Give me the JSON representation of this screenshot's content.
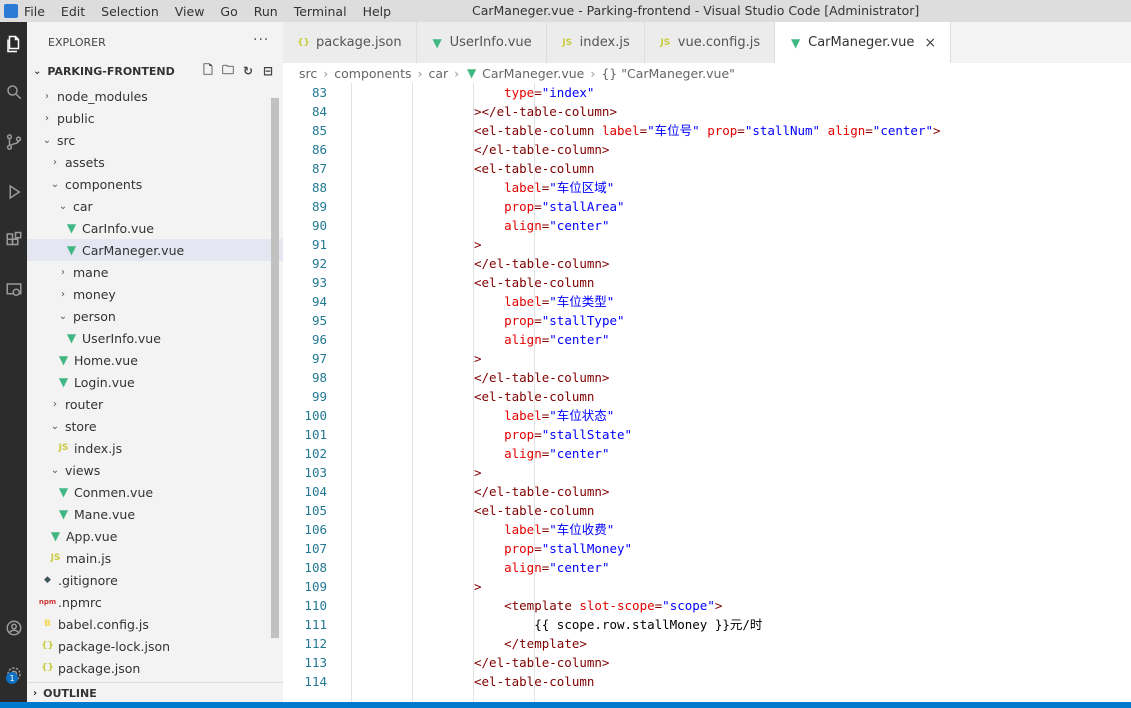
{
  "titlebar": {
    "menu": [
      "File",
      "Edit",
      "Selection",
      "View",
      "Go",
      "Run",
      "Terminal",
      "Help"
    ],
    "title": "CarManeger.vue - Parking-frontend - Visual Studio Code [Administrator]"
  },
  "sidebar": {
    "header": "EXPLORER",
    "more": "···",
    "project": "PARKING-FRONTEND",
    "outline": "OUTLINE",
    "tree": [
      {
        "label": "node_modules",
        "kind": "folder",
        "state": "closed",
        "depth": 1
      },
      {
        "label": "public",
        "kind": "folder",
        "state": "closed",
        "depth": 1
      },
      {
        "label": "src",
        "kind": "folder",
        "state": "open",
        "depth": 1
      },
      {
        "label": "assets",
        "kind": "folder",
        "state": "closed",
        "depth": 2
      },
      {
        "label": "components",
        "kind": "folder",
        "state": "open",
        "depth": 2
      },
      {
        "label": "car",
        "kind": "folder",
        "state": "open",
        "depth": 3
      },
      {
        "label": "CarInfo.vue",
        "kind": "vue",
        "depth": 4
      },
      {
        "label": "CarManeger.vue",
        "kind": "vue",
        "depth": 4,
        "selected": true
      },
      {
        "label": "mane",
        "kind": "folder",
        "state": "closed",
        "depth": 3
      },
      {
        "label": "money",
        "kind": "folder",
        "state": "closed",
        "depth": 3
      },
      {
        "label": "person",
        "kind": "folder",
        "state": "open",
        "depth": 3
      },
      {
        "label": "UserInfo.vue",
        "kind": "vue",
        "depth": 4
      },
      {
        "label": "Home.vue",
        "kind": "vue",
        "depth": 3
      },
      {
        "label": "Login.vue",
        "kind": "vue",
        "depth": 3
      },
      {
        "label": "router",
        "kind": "folder",
        "state": "closed",
        "depth": 2
      },
      {
        "label": "store",
        "kind": "folder",
        "state": "open",
        "depth": 2
      },
      {
        "label": "index.js",
        "kind": "js",
        "depth": 3
      },
      {
        "label": "views",
        "kind": "folder",
        "state": "open",
        "depth": 2
      },
      {
        "label": "Conmen.vue",
        "kind": "vue",
        "depth": 3
      },
      {
        "label": "Mane.vue",
        "kind": "vue",
        "depth": 3
      },
      {
        "label": "App.vue",
        "kind": "vue",
        "depth": 2
      },
      {
        "label": "main.js",
        "kind": "js",
        "depth": 2
      },
      {
        "label": ".gitignore",
        "kind": "git",
        "depth": 1
      },
      {
        "label": ".npmrc",
        "kind": "npm",
        "depth": 1
      },
      {
        "label": "babel.config.js",
        "kind": "babel",
        "depth": 1
      },
      {
        "label": "package-lock.json",
        "kind": "json",
        "depth": 1
      },
      {
        "label": "package.json",
        "kind": "json",
        "depth": 1
      }
    ]
  },
  "tabs": [
    {
      "label": "package.json",
      "kind": "json"
    },
    {
      "label": "UserInfo.vue",
      "kind": "vue"
    },
    {
      "label": "index.js",
      "kind": "js"
    },
    {
      "label": "vue.config.js",
      "kind": "js"
    },
    {
      "label": "CarManeger.vue",
      "kind": "vue",
      "active": true
    }
  ],
  "breadcrumb": [
    "src",
    "components",
    "car",
    "CarManeger.vue",
    "{} \"CarManeger.vue\""
  ],
  "editor": {
    "lines": [
      {
        "n": "83",
        "i": 1,
        "t": [
          [
            "attr",
            "type"
          ],
          [
            "tag",
            "="
          ],
          [
            "str",
            "\"index\""
          ]
        ]
      },
      {
        "n": "84",
        "i": 0,
        "t": [
          [
            "tag",
            "></el-table-column>"
          ]
        ]
      },
      {
        "n": "85",
        "i": 0,
        "t": [
          [
            "tag",
            "<el-table-column "
          ],
          [
            "attr",
            "label"
          ],
          [
            "tag",
            "="
          ],
          [
            "str",
            "\"车位号\" "
          ],
          [
            "attr",
            "prop"
          ],
          [
            "tag",
            "="
          ],
          [
            "str",
            "\"stallNum\" "
          ],
          [
            "attr",
            "align"
          ],
          [
            "tag",
            "="
          ],
          [
            "str",
            "\"center\""
          ],
          [
            "tag",
            ">"
          ]
        ]
      },
      {
        "n": "86",
        "i": 0,
        "t": [
          [
            "tag",
            "</el-table-column>"
          ]
        ]
      },
      {
        "n": "87",
        "i": 0,
        "t": [
          [
            "tag",
            "<el-table-column"
          ]
        ]
      },
      {
        "n": "88",
        "i": 1,
        "t": [
          [
            "attr",
            "label"
          ],
          [
            "tag",
            "="
          ],
          [
            "str",
            "\"车位区域\""
          ]
        ]
      },
      {
        "n": "89",
        "i": 1,
        "t": [
          [
            "attr",
            "prop"
          ],
          [
            "tag",
            "="
          ],
          [
            "str",
            "\"stallArea\""
          ]
        ]
      },
      {
        "n": "90",
        "i": 1,
        "t": [
          [
            "attr",
            "align"
          ],
          [
            "tag",
            "="
          ],
          [
            "str",
            "\"center\""
          ]
        ]
      },
      {
        "n": "91",
        "i": 0,
        "t": [
          [
            "tag",
            ">"
          ]
        ]
      },
      {
        "n": "92",
        "i": 0,
        "t": [
          [
            "tag",
            "</el-table-column>"
          ]
        ]
      },
      {
        "n": "93",
        "i": 0,
        "t": [
          [
            "tag",
            "<el-table-column"
          ]
        ]
      },
      {
        "n": "94",
        "i": 1,
        "t": [
          [
            "attr",
            "label"
          ],
          [
            "tag",
            "="
          ],
          [
            "str",
            "\"车位类型\""
          ]
        ]
      },
      {
        "n": "95",
        "i": 1,
        "t": [
          [
            "attr",
            "prop"
          ],
          [
            "tag",
            "="
          ],
          [
            "str",
            "\"stallType\""
          ]
        ]
      },
      {
        "n": "96",
        "i": 1,
        "t": [
          [
            "attr",
            "align"
          ],
          [
            "tag",
            "="
          ],
          [
            "str",
            "\"center\""
          ]
        ]
      },
      {
        "n": "97",
        "i": 0,
        "t": [
          [
            "tag",
            ">"
          ]
        ]
      },
      {
        "n": "98",
        "i": 0,
        "t": [
          [
            "tag",
            "</el-table-column>"
          ]
        ]
      },
      {
        "n": "99",
        "i": 0,
        "t": [
          [
            "tag",
            "<el-table-column"
          ]
        ]
      },
      {
        "n": "100",
        "i": 1,
        "t": [
          [
            "attr",
            "label"
          ],
          [
            "tag",
            "="
          ],
          [
            "str",
            "\"车位状态\""
          ]
        ]
      },
      {
        "n": "101",
        "i": 1,
        "t": [
          [
            "attr",
            "prop"
          ],
          [
            "tag",
            "="
          ],
          [
            "str",
            "\"stallState\""
          ]
        ]
      },
      {
        "n": "102",
        "i": 1,
        "t": [
          [
            "attr",
            "align"
          ],
          [
            "tag",
            "="
          ],
          [
            "str",
            "\"center\""
          ]
        ]
      },
      {
        "n": "103",
        "i": 0,
        "t": [
          [
            "tag",
            ">"
          ]
        ]
      },
      {
        "n": "104",
        "i": 0,
        "t": [
          [
            "tag",
            "</el-table-column>"
          ]
        ]
      },
      {
        "n": "105",
        "i": 0,
        "t": [
          [
            "tag",
            "<el-table-column"
          ]
        ]
      },
      {
        "n": "106",
        "i": 1,
        "t": [
          [
            "attr",
            "label"
          ],
          [
            "tag",
            "="
          ],
          [
            "str",
            "\"车位收费\""
          ]
        ]
      },
      {
        "n": "107",
        "i": 1,
        "t": [
          [
            "attr",
            "prop"
          ],
          [
            "tag",
            "="
          ],
          [
            "str",
            "\"stallMoney\""
          ]
        ]
      },
      {
        "n": "108",
        "i": 1,
        "t": [
          [
            "attr",
            "align"
          ],
          [
            "tag",
            "="
          ],
          [
            "str",
            "\"center\""
          ]
        ]
      },
      {
        "n": "109",
        "i": 0,
        "t": [
          [
            "tag",
            ">"
          ]
        ]
      },
      {
        "n": "110",
        "i": 1,
        "t": [
          [
            "tag",
            "<template "
          ],
          [
            "attr",
            "slot-scope"
          ],
          [
            "tag",
            "="
          ],
          [
            "str",
            "\"scope\""
          ],
          [
            "tag",
            ">"
          ]
        ]
      },
      {
        "n": "111",
        "i": 2,
        "t": [
          [
            "txt",
            "{{ scope.row.stallMoney }}元/时"
          ]
        ]
      },
      {
        "n": "112",
        "i": 1,
        "t": [
          [
            "tag",
            "</template>"
          ]
        ]
      },
      {
        "n": "113",
        "i": 0,
        "t": [
          [
            "tag",
            "</el-table-column>"
          ]
        ]
      },
      {
        "n": "114",
        "i": 0,
        "t": [
          [
            "tag",
            "<el-table-column"
          ]
        ]
      }
    ]
  },
  "colors": {
    "activity_bar": "#2c2c2c",
    "sidebar": "#f3f3f3",
    "selection": "#e4e6f1",
    "status_bar": "#007acc",
    "vue_icon": "#41b883",
    "tag": "#800000",
    "attr": "#e50000",
    "string": "#0000ff"
  },
  "icons": {
    "activity": [
      "files-icon",
      "search-icon",
      "source-control-icon",
      "run-debug-icon",
      "extensions-icon",
      "remote-explorer-icon",
      "account-icon",
      "settings-gear-icon"
    ],
    "badge": "1"
  }
}
